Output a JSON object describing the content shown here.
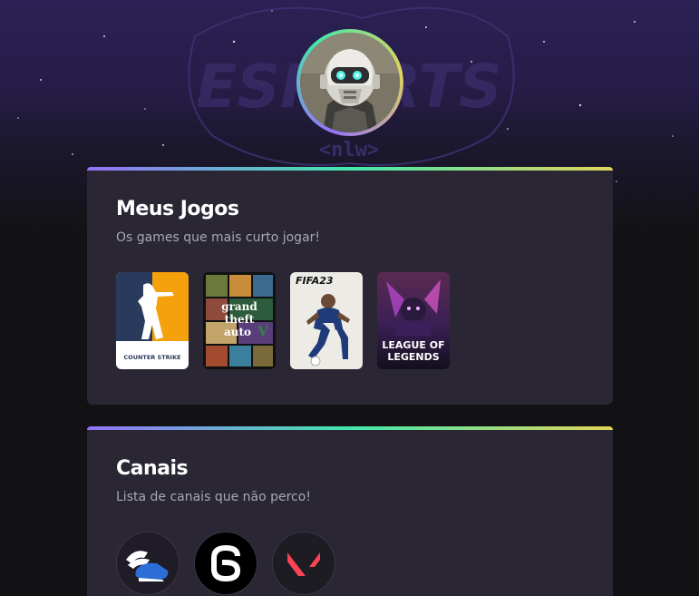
{
  "profile": {
    "avatar_icon": "robot-soldier-avatar",
    "ring_colors": [
      "#9572fc",
      "#43e7ad",
      "#e2d45c"
    ],
    "background_watermark": {
      "logo_text": "ESPORTS",
      "logo_subtext": "<nlw>"
    }
  },
  "games_section": {
    "title": "Meus Jogos",
    "subtitle": "Os games que mais curto jogar!",
    "games": [
      {
        "name": "Counter Strike",
        "cover_text": "COUNTER STRIKE",
        "icon": "counter-strike-cover"
      },
      {
        "name": "Grand Theft Auto V",
        "cover_text": "grand theft auto",
        "icon": "gta-v-cover"
      },
      {
        "name": "FIFA 23",
        "cover_text": "FIFA23",
        "icon": "fifa-23-cover"
      },
      {
        "name": "League of Legends",
        "cover_text_line1": "LEAGUE OF",
        "cover_text_line2": "LEGENDS",
        "icon": "league-of-legends-cover"
      }
    ]
  },
  "channels_section": {
    "title": "Canais",
    "subtitle": "Lista de canais que não perco!",
    "channels": [
      {
        "icon": "winged-shoe-channel-icon"
      },
      {
        "icon": "rainbow-six-channel-icon"
      },
      {
        "icon": "valorant-channel-icon"
      }
    ]
  },
  "colors": {
    "page_bg": "#121214",
    "hero_top": "#2b2154",
    "card_bg": "#2a2634",
    "title": "#ffffff",
    "subtitle": "#a8a8b3",
    "gradient": [
      "#9572fc",
      "#43e7ad",
      "#e2d45c"
    ]
  }
}
